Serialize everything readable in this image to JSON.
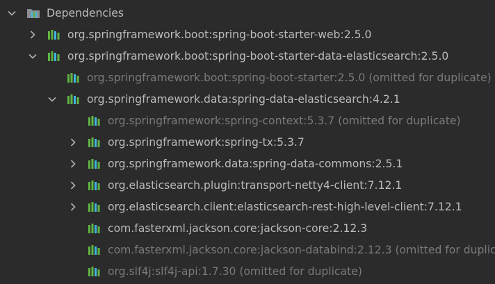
{
  "tree": {
    "root": {
      "label": "Dependencies",
      "expanded": true,
      "icon": "library-folder-icon"
    },
    "items": [
      {
        "label": "org.springframework.boot:spring-boot-starter-web:2.5.0",
        "expanded": false,
        "omitted": false
      },
      {
        "label": "org.springframework.boot:spring-boot-starter-data-elasticsearch:2.5.0",
        "expanded": true,
        "omitted": false
      },
      {
        "label": "org.springframework.boot:spring-boot-starter:2.5.0 (omitted for duplicate)",
        "omitted": true
      },
      {
        "label": "org.springframework.data:spring-data-elasticsearch:4.2.1",
        "expanded": true,
        "omitted": false
      },
      {
        "label": "org.springframework:spring-context:5.3.7 (omitted for duplicate)",
        "omitted": true
      },
      {
        "label": "org.springframework:spring-tx:5.3.7",
        "expanded": false,
        "omitted": false
      },
      {
        "label": "org.springframework.data:spring-data-commons:2.5.1",
        "expanded": false,
        "omitted": false
      },
      {
        "label": "org.elasticsearch.plugin:transport-netty4-client:7.12.1",
        "expanded": false,
        "omitted": false
      },
      {
        "label": "org.elasticsearch.client:elasticsearch-rest-high-level-client:7.12.1",
        "expanded": false,
        "omitted": false
      },
      {
        "label": "com.fasterxml.jackson.core:jackson-core:2.12.3",
        "omitted": false
      },
      {
        "label": "com.fasterxml.jackson.core:jackson-databind:2.12.3 (omitted for duplicate)",
        "omitted": true
      },
      {
        "label": "org.slf4j:slf4j-api:1.7.30 (omitted for duplicate)",
        "omitted": true
      }
    ]
  },
  "colors": {
    "background": "#2b2b2b",
    "text": "#bbbbbb",
    "text_dim": "#7a7a7a",
    "library_icon_green": "#62b543",
    "library_icon_blue": "#40b6e0",
    "chevron": "#afb1b3"
  }
}
